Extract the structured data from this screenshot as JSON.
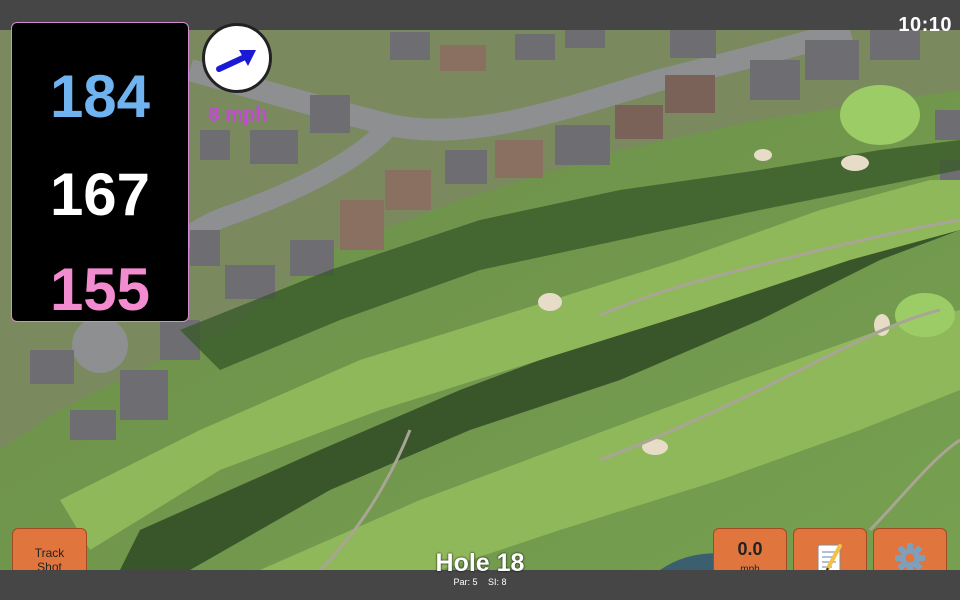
{
  "status": {
    "time": "10:10"
  },
  "distances": {
    "back": "184",
    "middle": "167",
    "front": "155"
  },
  "wind": {
    "speed": "8 mph"
  },
  "buttons": {
    "track_shot": "Track\nShot",
    "speed_value": "0.0",
    "speed_unit": "mph",
    "notes_icon": "notepad-icon",
    "settings_icon": "gear-icon"
  },
  "hole": {
    "title": "Hole 18",
    "par": "Par: 5",
    "si": "SI: 8"
  },
  "colors": {
    "back": "#6fb3f0",
    "middle": "#ffffff",
    "front": "#f38bd0",
    "wind_text": "#c24bd6",
    "wind_arrow": "#1a1ad6",
    "button": "#e0753d",
    "panel_border": "#d58cd3"
  }
}
